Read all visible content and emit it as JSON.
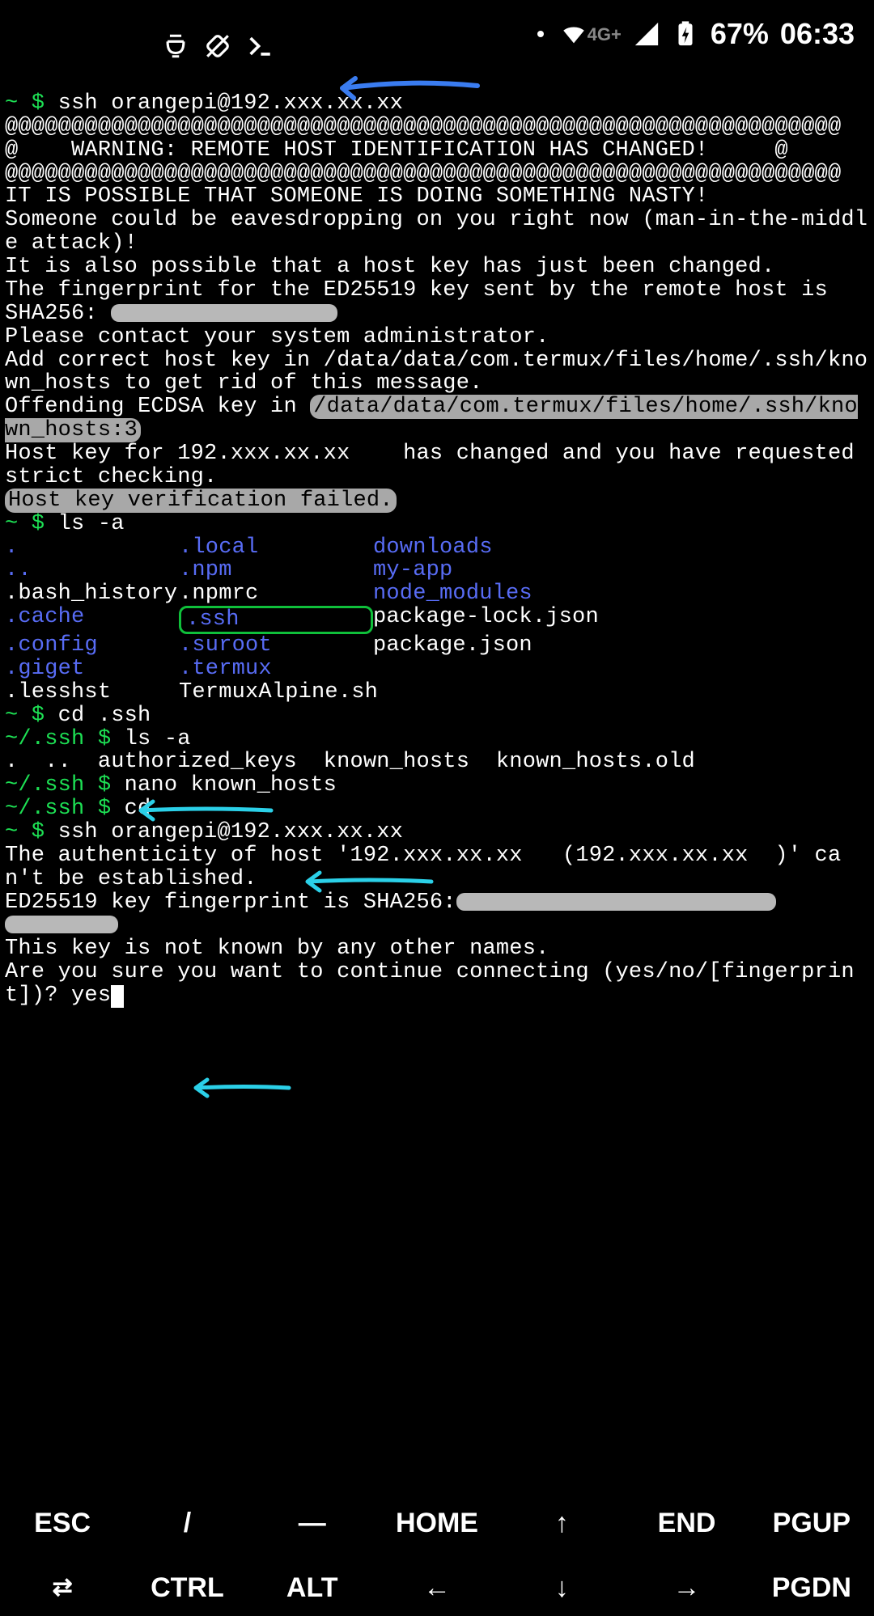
{
  "statusbar": {
    "net_label": "4G+",
    "battery": "67%",
    "time": "06:33"
  },
  "term": {
    "prompt_home": "~ $ ",
    "cmd_ssh1": "ssh orangepi@192.xxx.xx.xx",
    "at_line": "@@@@@@@@@@@@@@@@@@@@@@@@@@@@@@@@@@@@@@@@@@@@@@@@@@@@@@@@@@@@@@@",
    "warn_line": "@    WARNING: REMOTE HOST IDENTIFICATION HAS CHANGED!     @",
    "body1": "IT IS POSSIBLE THAT SOMEONE IS DOING SOMETHING NASTY!",
    "body2": "Someone could be eavesdropping on you right now (man-in-the-middle attack)!",
    "body3": "It is also possible that a host key has just been changed.",
    "body4": "The fingerprint for the ED25519 key sent by the remote host is",
    "sha_label": "SHA256:",
    "body5": "Please contact your system administrator.",
    "body6": "Add correct host key in /data/data/com.termux/files/home/.ssh/known_hosts to get rid of this message.",
    "offend_pre": "Offending ECDSA key in ",
    "offend_path": "/data/data/com.termux/files/home/.ssh/known_hosts:3",
    "body7a": "Host key for 192.xxx.xx.xx    has changed and you have requested strict checking.",
    "fail": "Host key verification failed.",
    "cmd_ls": "ls -a",
    "ls": {
      "c1": [
        ".",
        "..",
        ".bash_history",
        ".cache",
        ".config",
        ".giget",
        ".lesshst"
      ],
      "c2": [
        ".local",
        ".npm",
        ".npmrc",
        ".ssh",
        ".suroot",
        ".termux",
        "TermuxAlpine.sh"
      ],
      "c3": [
        "downloads",
        "my-app",
        "node_modules",
        "package-lock.json",
        "package.json",
        "",
        ""
      ]
    },
    "cmd_cd_ssh": "cd .ssh",
    "prompt_ssh": "~/.ssh $ ",
    "cmd_ls2": "ls -a",
    "ls2": ".  ..  authorized_keys  known_hosts  known_hosts.old",
    "cmd_nano": "nano known_hosts",
    "cmd_cd": "cd",
    "cmd_ssh2": "ssh orangepi@192.xxx.xx.xx",
    "auth1": "The authenticity of host '192.xxx.xx.xx   (192.xxx.xx.xx  )' can't be established.",
    "auth2_pre": "ED25519 key fingerprint is SHA256:",
    "auth3": "This key is not known by any other names.",
    "auth4": "Are you sure you want to continue connecting (yes/no/[fingerprint])? ",
    "answer": "yes"
  },
  "keys": {
    "row1": [
      "ESC",
      "/",
      "—",
      "HOME",
      "↑",
      "END",
      "PGUP"
    ],
    "row2": [
      "⇄",
      "CTRL",
      "ALT",
      "←",
      "↓",
      "→",
      "PGDN"
    ]
  },
  "arrow_color": "#2bd0e8",
  "arrow_color_blue": "#3a7cf0"
}
